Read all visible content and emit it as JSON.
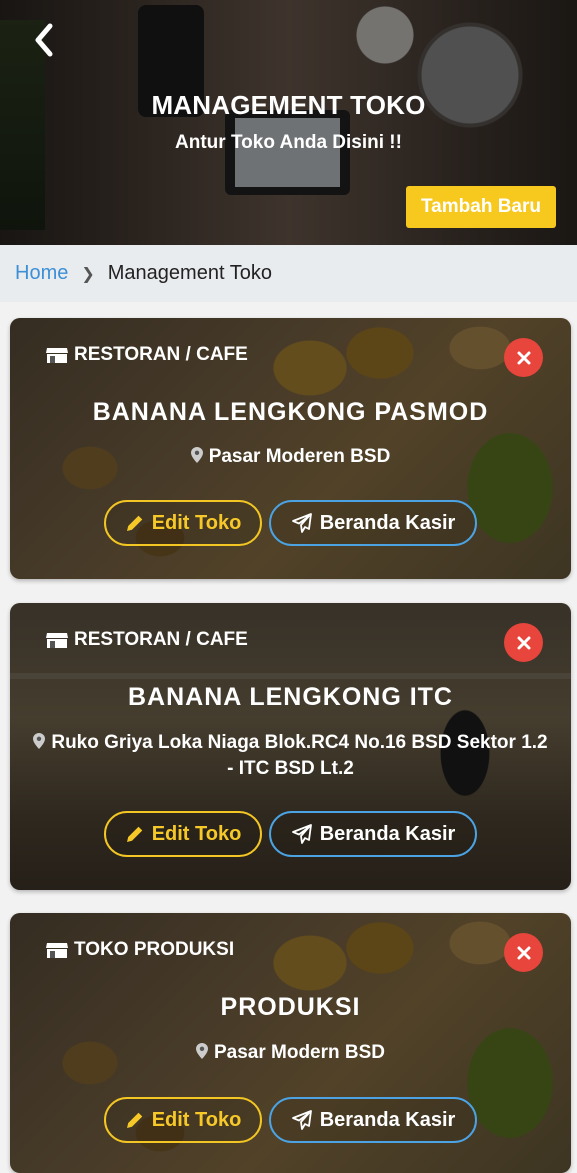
{
  "header": {
    "title": "MANAGEMENT TOKO",
    "subtitle": "Antur Toko Anda Disini !!",
    "add_button_label": "Tambah Baru",
    "back_icon": "chevron-left-icon"
  },
  "breadcrumb": {
    "home": "Home",
    "current": "Management Toko"
  },
  "colors": {
    "accent_yellow": "#f7c81e",
    "accent_blue": "#3d8fd6",
    "danger_red": "#e8453c"
  },
  "stores": [
    {
      "category": "RESTORAN / CAFE",
      "name": "BANANA LENGKONG PASMOD",
      "address": "Pasar Moderen BSD",
      "edit_label": "Edit Toko",
      "kasir_label": "Beranda Kasir"
    },
    {
      "category": "RESTORAN / CAFE",
      "name": "BANANA LENGKONG ITC",
      "address": "Ruko Griya Loka Niaga Blok.RC4 No.16 BSD Sektor 1.2 - ITC BSD Lt.2",
      "edit_label": "Edit Toko",
      "kasir_label": "Beranda Kasir"
    },
    {
      "category": "TOKO PRODUKSI",
      "name": "PRODUKSI",
      "address": "Pasar Modern BSD",
      "edit_label": "Edit Toko",
      "kasir_label": "Beranda Kasir"
    }
  ]
}
